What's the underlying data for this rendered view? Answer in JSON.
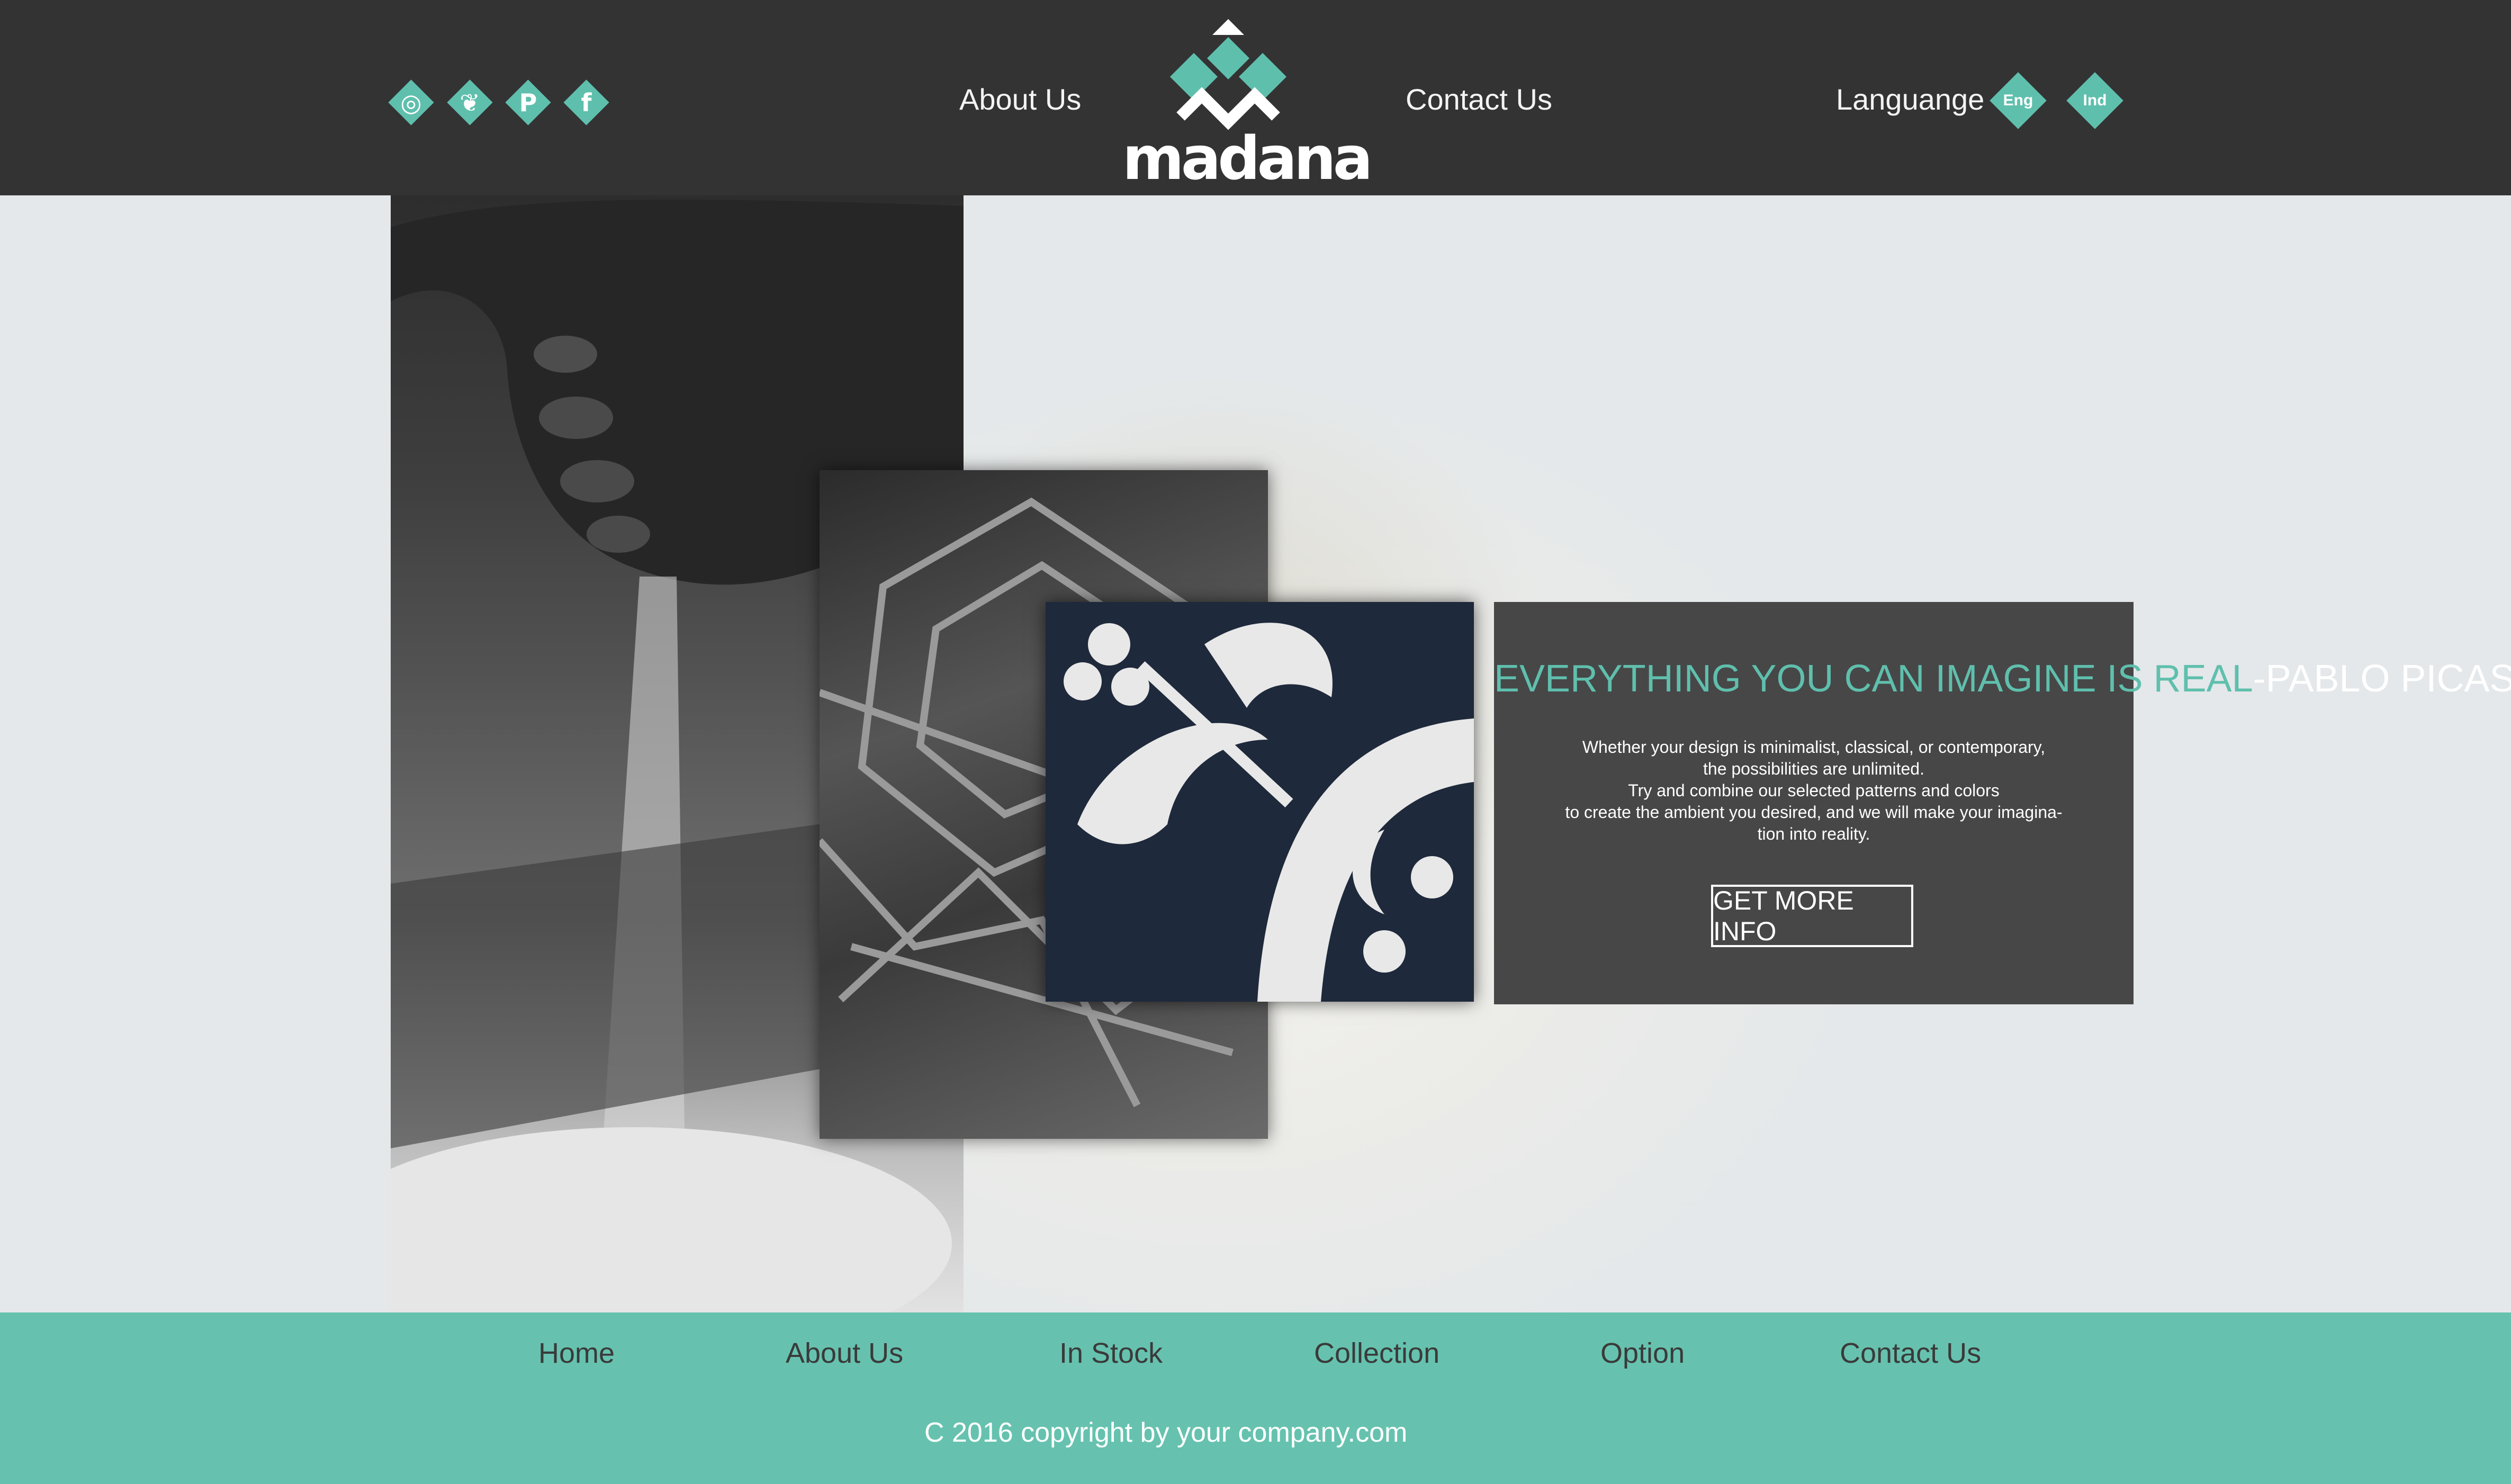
{
  "header": {
    "social": [
      {
        "name": "instagram",
        "icon": "instagram-icon",
        "glyph": "◎"
      },
      {
        "name": "twitter",
        "icon": "twitter-icon",
        "glyph": "❦"
      },
      {
        "name": "pinterest",
        "icon": "pinterest-icon",
        "glyph": "P"
      },
      {
        "name": "facebook",
        "icon": "facebook-icon",
        "glyph": "f"
      }
    ],
    "nav": {
      "about": "About Us",
      "contact": "Contact Us"
    },
    "logo_text": "madana",
    "language_label": "Languange",
    "languages": [
      "Eng",
      "Ind"
    ]
  },
  "hero": {
    "quote": "EVERYTHING YOU CAN IMAGINE IS REAL",
    "author": "-PABLO PICASSO-",
    "body_lines": [
      "Whether your design is minimalist, classical, or contemporary,",
      "the possibilities are unlimited.",
      "Try and combine our selected patterns and colors",
      "to create the ambient you desired, and we will make your imagina-",
      "tion into reality."
    ],
    "cta": "GET MORE INFO"
  },
  "footer": {
    "nav": [
      "Home",
      "About Us",
      "In Stock",
      "Collection",
      "Option",
      "Contact Us"
    ],
    "copyright": "C 2016 copyright by your company.com"
  },
  "colors": {
    "accent": "#5fbfad",
    "footer": "#66c2af",
    "header": "#333333",
    "panel": "#474747"
  }
}
